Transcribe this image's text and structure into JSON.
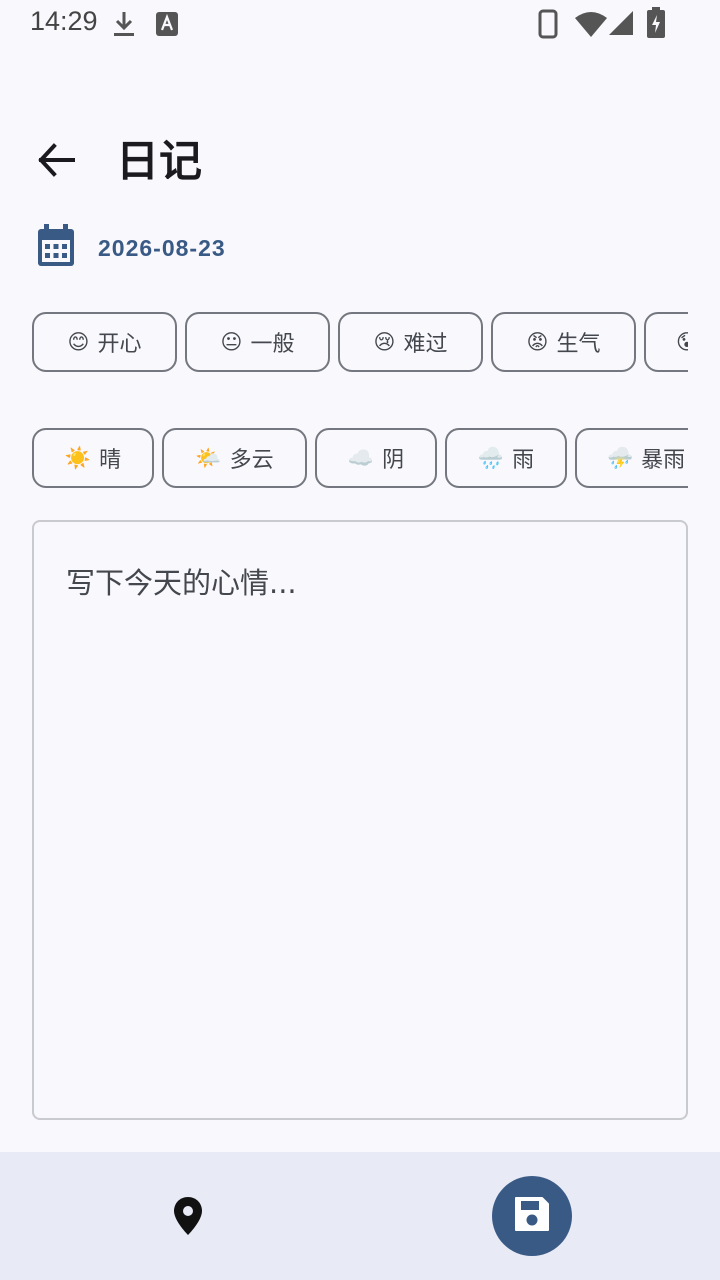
{
  "status_bar": {
    "time": "14:29",
    "icons": [
      "download-icon",
      "text-a-icon",
      "phone-icon",
      "wifi-icon",
      "signal-icon",
      "battery-charging-icon"
    ]
  },
  "header": {
    "title": "日记",
    "back_icon": "arrow-left-icon"
  },
  "date": {
    "icon": "calendar-icon",
    "value": "2026-08-23"
  },
  "moods": [
    {
      "emoji": "😊",
      "label": "开心"
    },
    {
      "emoji": "😐",
      "label": "一般"
    },
    {
      "emoji": "😢",
      "label": "难过"
    },
    {
      "emoji": "😡",
      "label": "生气"
    },
    {
      "emoji": "😰",
      "label": ""
    }
  ],
  "weather": [
    {
      "emoji": "☀️",
      "label": "晴"
    },
    {
      "emoji": "🌤️",
      "label": "多云"
    },
    {
      "emoji": "☁️",
      "label": "阴"
    },
    {
      "emoji": "🌧️",
      "label": "雨"
    },
    {
      "emoji": "⛈️",
      "label": "暴雨"
    }
  ],
  "editor": {
    "placeholder": "写下今天的心情..."
  },
  "bottom_bar": {
    "location_icon": "location-pin-icon",
    "save_icon": "save-icon"
  },
  "colors": {
    "accent": "#3a5a86",
    "background": "#f8f8fd",
    "bottom_bar": "#e8ebf5",
    "chip_border": "#74777f"
  }
}
